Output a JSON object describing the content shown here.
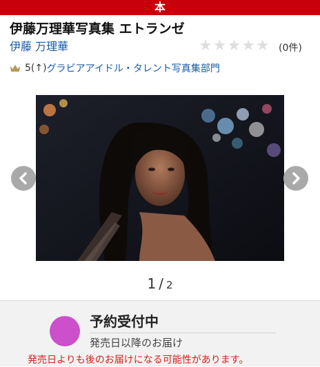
{
  "header": {
    "category": "本"
  },
  "product": {
    "title": "伊藤万理華写真集 エトランゼ",
    "author": "伊藤 万理華",
    "rating_stars": 0,
    "review_count": "(0件)",
    "rank": "5(↑)",
    "rank_category": "グラビアアイドル・タレント写真集部門"
  },
  "gallery": {
    "current": "1",
    "separator": "/",
    "total": "2"
  },
  "status": {
    "label": "予約受付中",
    "delivery": "発売日以降のお届け",
    "warning": "発売日よりも後のお届けになる可能性があります。",
    "dot_color": "#cc4fcc"
  },
  "colors": {
    "brand": "#c8000b",
    "link": "#1a5aa8",
    "warning": "#d2231e"
  }
}
